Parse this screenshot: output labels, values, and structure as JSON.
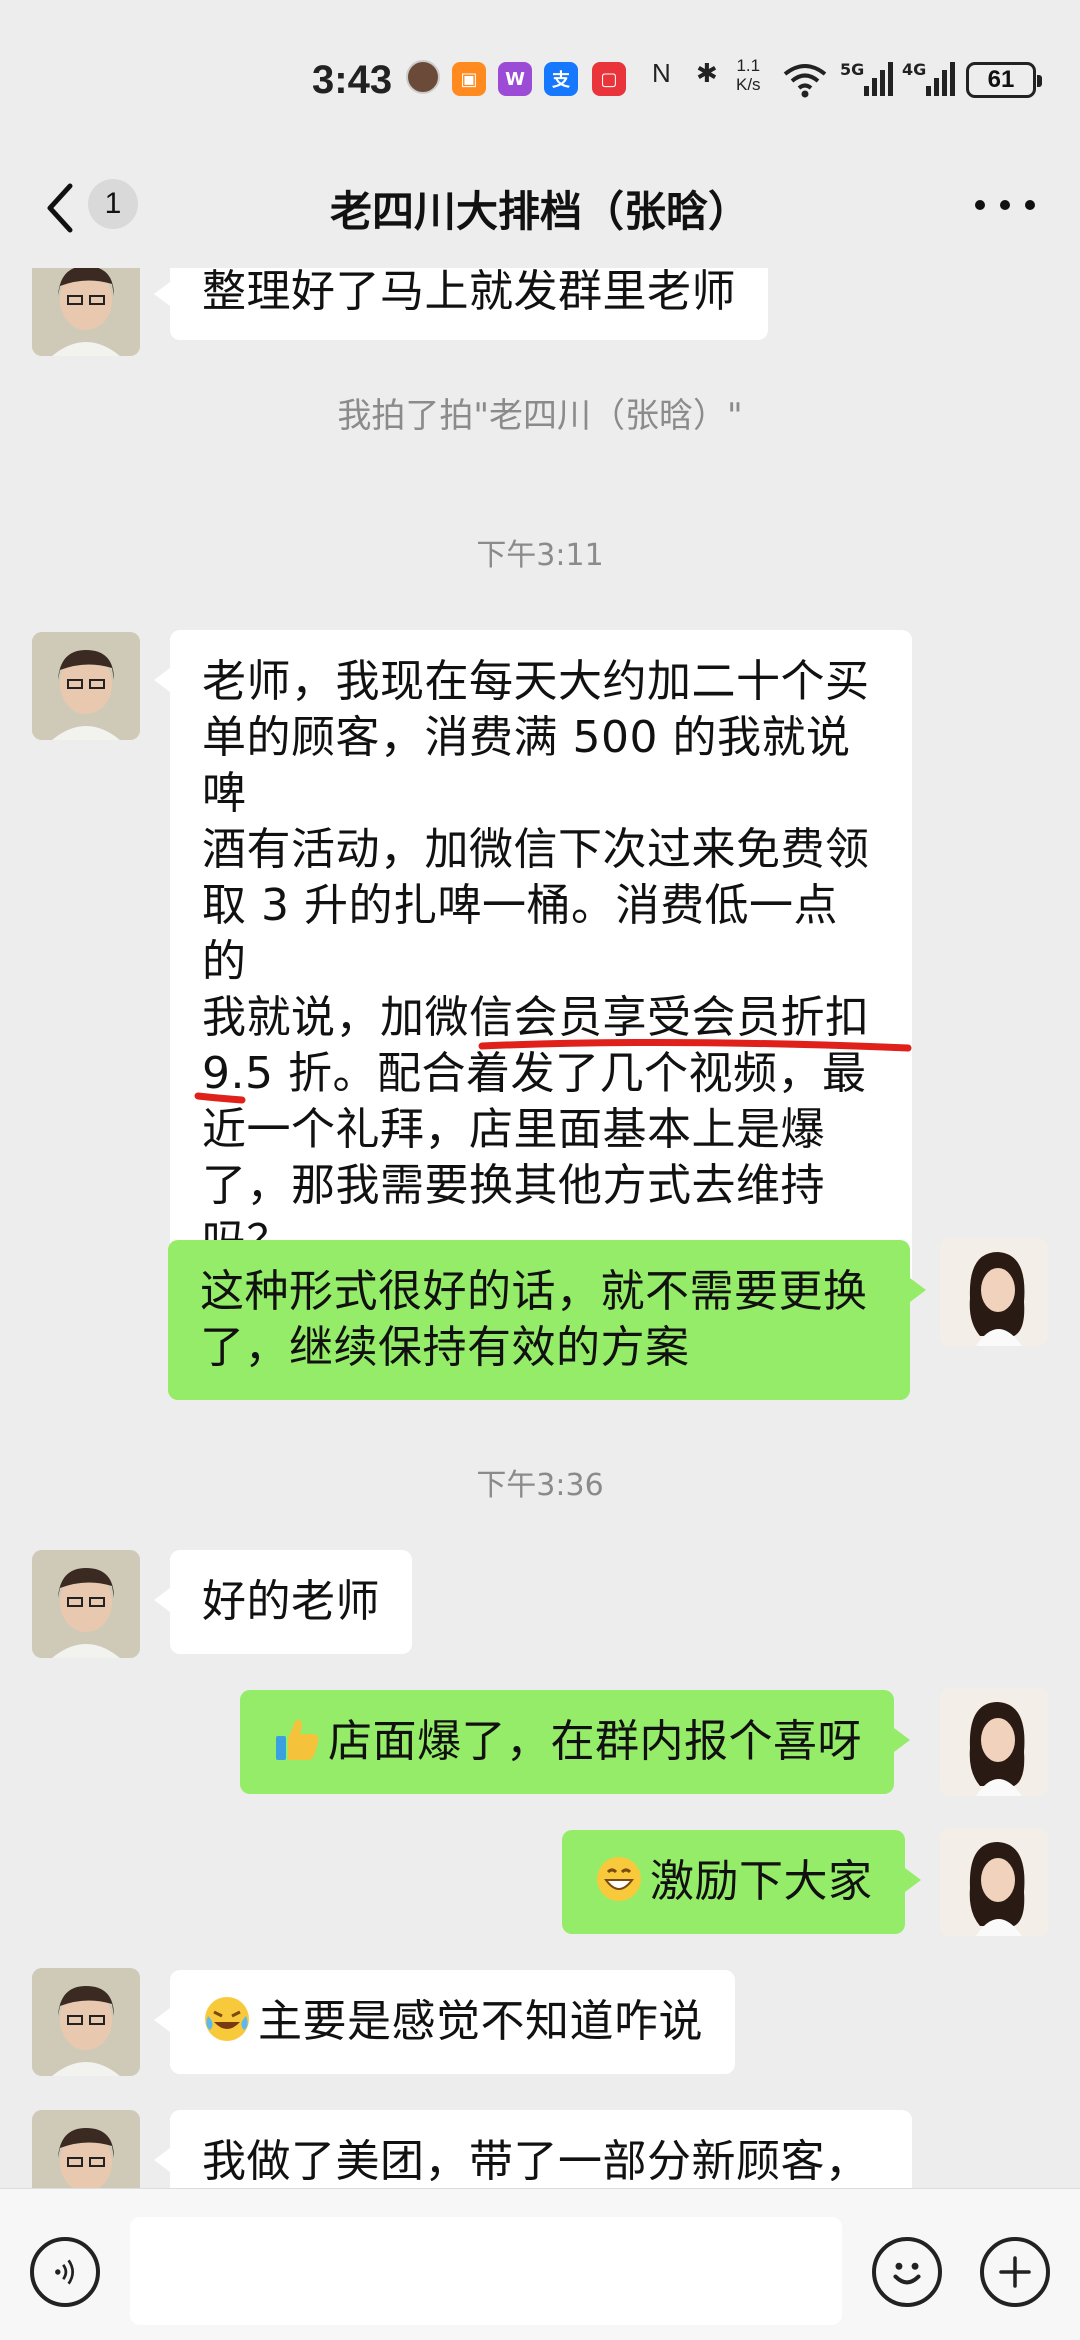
{
  "status_bar": {
    "time": "3:43",
    "app_icons": [
      "taobao-icon",
      "weibo-icon",
      "alipay-icon",
      "red-app-icon"
    ],
    "net_speed_value": "1.1",
    "net_speed_unit": "K/s",
    "signal_1": "5G",
    "signal_2": "4G",
    "battery": "61"
  },
  "header": {
    "back_badge": "1",
    "title": "老四川大排档（张晗）"
  },
  "messages": {
    "m0": "整理好了马上就发群里老师",
    "system_pat": "我拍了拍\"老四川（张晗）\"",
    "time_1": "下午3:11",
    "m1_line1": "老师，我现在每天大约加二十个买",
    "m1_line2": "单的顾客，消费满 500 的我就说啤",
    "m1_line3": "酒有活动，加微信下次过来免费领",
    "m1_line4": "取 3 升的扎啤一桶。消费低一点的",
    "m1_line5": "我就说，加微信会员享受会员折扣",
    "m1_line6": "9.5 折。配合着发了几个视频，最",
    "m1_line7": "近一个礼拜，店里面基本上是爆",
    "m1_line8": "了，那我需要换其他方式去维持",
    "m1_line9": "吗？",
    "m2_line1": "这种形式很好的话，就不需要更换",
    "m2_line2": "了，继续保持有效的方案",
    "time_2": "下午3:36",
    "m3": "好的老师",
    "m4": "店面爆了，在群内报个喜呀",
    "m5": "激励下大家",
    "m6": "主要是感觉不知道咋说",
    "m7": "我做了美团，带了一部分新顾客，"
  },
  "colors": {
    "chat_bg": "#ededed",
    "bubble_out": "#95ec69",
    "bubble_in": "#ffffff",
    "annotation_red": "#e0201b"
  }
}
